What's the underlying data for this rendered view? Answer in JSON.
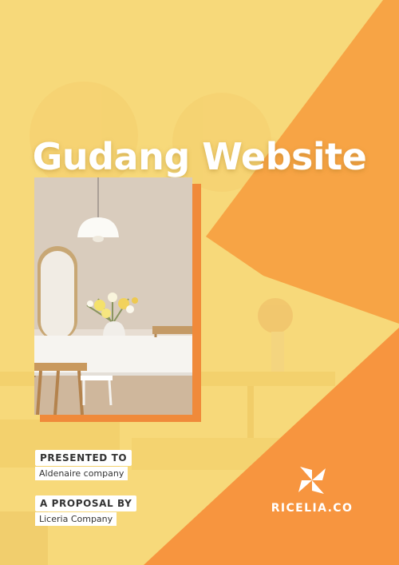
{
  "title": "Gudang Website",
  "presented_to": {
    "label": "PRESENTED TO",
    "value": "Aldenaire company"
  },
  "proposal_by": {
    "label": "A PROPOSAL BY",
    "value": "Liceria Company"
  },
  "brand": {
    "name": "RICELIA.CO",
    "logo_icon": "pinwheel-logo-icon"
  },
  "colors": {
    "yellow_overlay": "#f7d66a",
    "orange_primary": "#f7953f",
    "orange_light": "#f8b24e",
    "white": "#ffffff"
  }
}
